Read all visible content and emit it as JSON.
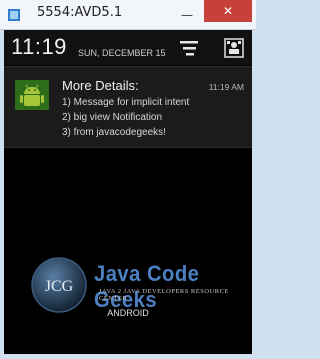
{
  "window": {
    "title": "5554:AVD5.1",
    "minimize_glyph": "—",
    "close_glyph": "✕",
    "close_color": "#c7413a"
  },
  "status": {
    "time": "11:19",
    "date": "SUN, DECEMBER 15"
  },
  "notification": {
    "title": "More Details:",
    "time": "11:19 AM",
    "lines": [
      "1) Message for implicit intent",
      "2) big view Notification",
      "3) from javacodegeeks!"
    ],
    "icon": "android-icon"
  },
  "wallpaper": {
    "logo_text": "JCG",
    "brand": "Java Code Geeks",
    "tagline": "JAVA 2 JAVA DEVELOPERS RESOURCE CENTER",
    "caption": "ANDROID"
  }
}
